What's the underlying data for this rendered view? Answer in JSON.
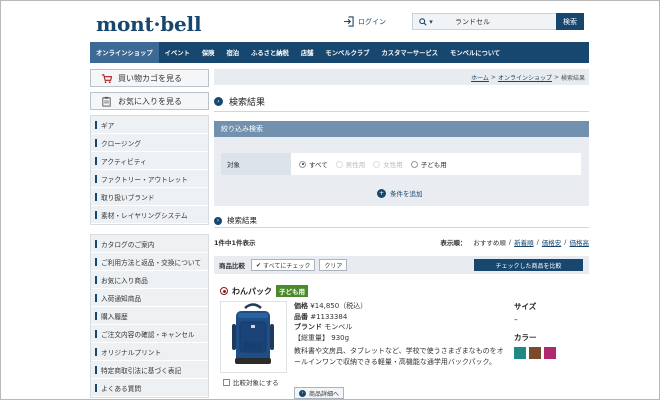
{
  "header": {
    "logo": "mont·bell",
    "login": "ログイン",
    "search": {
      "value": "ランドセル",
      "button": "検索"
    }
  },
  "nav": [
    "オンラインショップ",
    "イベント",
    "保険",
    "宿泊",
    "ふるさと納税",
    "店舗",
    "モンベルクラブ",
    "カスタマーサービス",
    "モンベルについて"
  ],
  "sidebar": {
    "cart": "買い物カゴを見る",
    "favorites": "お気に入りを見る",
    "categories": [
      "ギア",
      "クロージング",
      "アクティビティ",
      "ファクトリー・アウトレット",
      "取り扱いブランド",
      "素材・レイヤリングシステム"
    ],
    "support": [
      "カタログのご案内",
      "ご利用方法と返品・交換について",
      "お気に入り商品",
      "入荷通知商品",
      "購入履歴",
      "ご注文内容の確認・キャンセル",
      "オリジナルプリント",
      "特定商取引法に基づく表記",
      "よくある質問"
    ]
  },
  "breadcrumb": {
    "home": "ホーム",
    "shop": "オンラインショップ",
    "current": "検索結果",
    "sep": ">"
  },
  "page_title": "検索結果",
  "filter": {
    "header": "絞り込み検索",
    "label": "対象",
    "options": [
      {
        "label": "すべて",
        "selected": true,
        "disabled": false
      },
      {
        "label": "男性用",
        "selected": false,
        "disabled": true
      },
      {
        "label": "女性用",
        "selected": false,
        "disabled": true
      },
      {
        "label": "子ども用",
        "selected": false,
        "disabled": false
      }
    ],
    "add_condition": "条件を追加"
  },
  "results": {
    "title": "検索結果",
    "count": "1件中1件表示",
    "sort_label": "表示順：",
    "sort": [
      "おすすめ順",
      "新着順",
      "価格安",
      "価格高"
    ],
    "sort_sep": "/"
  },
  "compare": {
    "title": "商品比較",
    "check_all": "すべてにチェック",
    "clear": "クリア",
    "compare_checked": "チェックした商品を比較"
  },
  "product": {
    "name": "わんパック",
    "badge": "子ども用",
    "price_label": "価格",
    "price": "¥14,850（税込）",
    "sku_label": "品番",
    "sku": "#1133384",
    "brand_label": "ブランド",
    "brand": "モンベル",
    "weight_label": "【総重量】",
    "weight": "930g",
    "description": "教科書や文房具、タブレットなど、学校で使うさまざまなものをオールインワンで収納できる軽量・高機能な通学用バックパック。",
    "compare_check": "比較対象にする",
    "detail": "商品詳細へ",
    "size_label": "サイズ",
    "size_value": "–",
    "color_label": "カラー",
    "colors": [
      "#1f8a84",
      "#7a4a2a",
      "#b0286e"
    ]
  }
}
